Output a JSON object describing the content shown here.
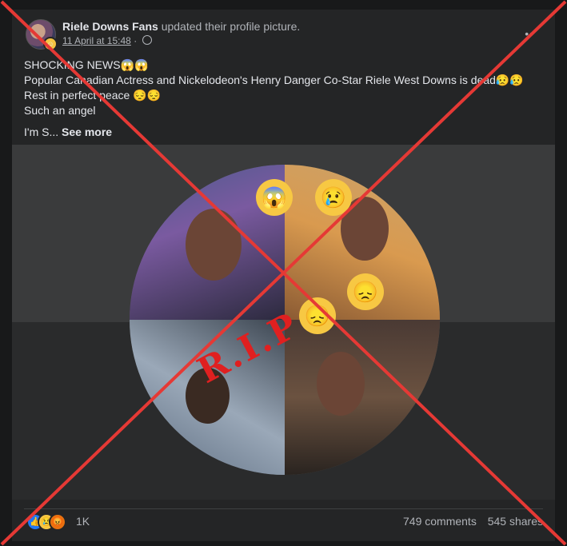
{
  "post": {
    "page_name": "Riele Downs Fans",
    "action": "updated their profile picture.",
    "timestamp": "11 April at 15:48",
    "more_label": "••",
    "lines": [
      "SHOCKING NEWS😱😱",
      "Popular Canadian Actress and Nickelodeon's Henry Danger Co-Star Riele West Downs is dead😥😥",
      "Rest in perfect peace 😔😔",
      "Such an angel"
    ],
    "truncated_text": "I'm S...",
    "see_more": "See more"
  },
  "image": {
    "overlay_text": "R.I.P",
    "emojis": [
      "😱",
      "😢",
      "😞",
      "😞"
    ]
  },
  "footer": {
    "reactions": [
      "like",
      "sad",
      "angry"
    ],
    "reaction_count": "1K",
    "comments": "749 comments",
    "shares": "545 shares"
  },
  "overlay": {
    "cross_color": "#e53935"
  }
}
